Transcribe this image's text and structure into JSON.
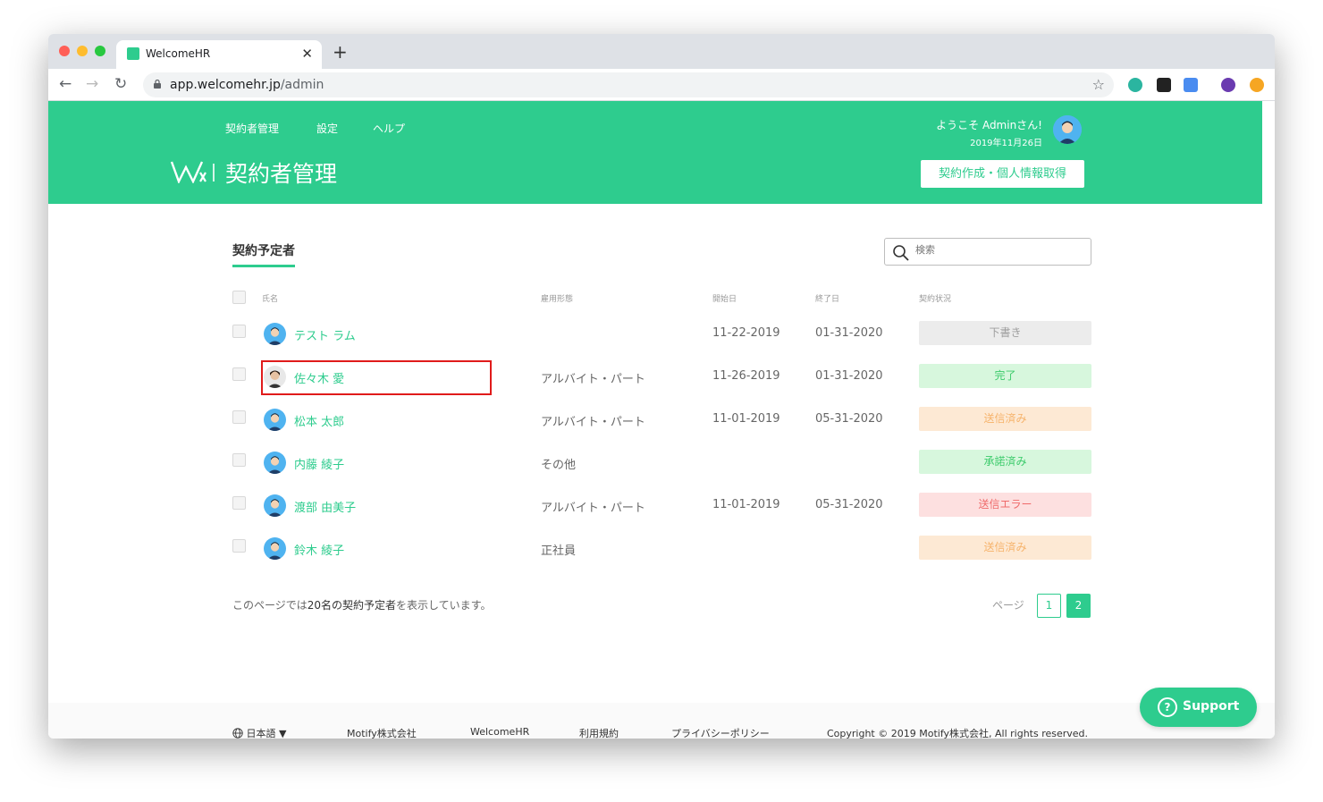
{
  "browser": {
    "tab_title": "WelcomeHR",
    "url_host": "app.welcomehr.jp",
    "url_path": "/admin"
  },
  "header": {
    "nav": [
      "契約者管理",
      "設定",
      "ヘルプ"
    ],
    "title": "契約者管理",
    "welcome": "ようこそ Adminさん!",
    "date": "2019年11月26日",
    "create_button": "契約作成・個人情報取得"
  },
  "content": {
    "section_tab": "契約予定者",
    "search_placeholder": "検索",
    "columns": {
      "name": "氏名",
      "employment": "雇用形態",
      "start": "開始日",
      "end": "終了日",
      "status": "契約状況"
    },
    "rows": [
      {
        "name": "テスト ラム",
        "employment": "",
        "start": "11-22-2019",
        "end": "01-31-2020",
        "status": "下書き",
        "status_type": "draft"
      },
      {
        "name": "佐々木 愛",
        "employment": "アルバイト・パート",
        "start": "11-26-2019",
        "end": "01-31-2020",
        "status": "完了",
        "status_type": "done"
      },
      {
        "name": "松本 太郎",
        "employment": "アルバイト・パート",
        "start": "11-01-2019",
        "end": "05-31-2020",
        "status": "送信済み",
        "status_type": "sent"
      },
      {
        "name": "内藤 綾子",
        "employment": "その他",
        "start": "",
        "end": "",
        "status": "承諾済み",
        "status_type": "accepted"
      },
      {
        "name": "渡部 由美子",
        "employment": "アルバイト・パート",
        "start": "11-01-2019",
        "end": "05-31-2020",
        "status": "送信エラー",
        "status_type": "error"
      },
      {
        "name": "鈴木 綾子",
        "employment": "正社員",
        "start": "",
        "end": "",
        "status": "送信済み",
        "status_type": "sent"
      }
    ],
    "summary_prefix": "このページでは",
    "summary_count": "20名の契約予定者",
    "summary_suffix": "を表示しています。",
    "page_label": "ページ",
    "pages": [
      "1",
      "2"
    ]
  },
  "support_label": "Support",
  "footer": {
    "language": "日本語",
    "company": "Motify株式会社",
    "product": "WelcomeHR",
    "terms": "利用規約",
    "privacy": "プライバシーポリシー",
    "copyright": "Copyright © 2019 Motify株式会社, All rights reserved."
  },
  "colors": {
    "brand": "#2ecc8e",
    "draft_bg": "#ececec",
    "draft_fg": "#9e9e9e",
    "done_bg": "#d7f7dd",
    "done_fg": "#3ccb6b",
    "sent_bg": "#fde9d4",
    "sent_fg": "#f6b36b",
    "accepted_bg": "#d7f7dd",
    "accepted_fg": "#3ccb6b",
    "error_bg": "#fde0e0",
    "error_fg": "#ef6b6b",
    "highlight": "#e01b1b"
  }
}
